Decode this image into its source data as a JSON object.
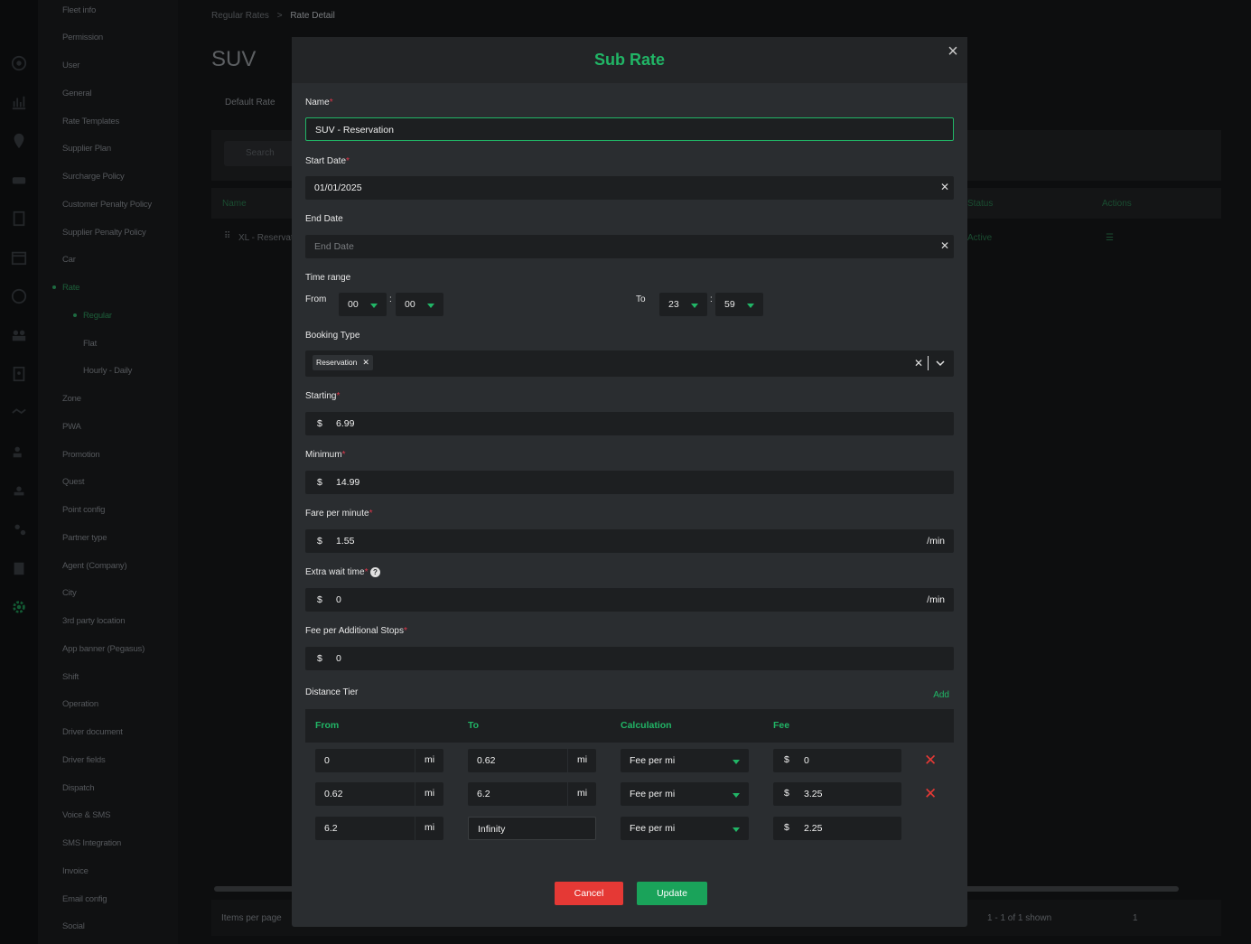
{
  "sidebar": {
    "items": [
      "Fleet info",
      "Permission",
      "User",
      "General",
      "Rate Templates",
      "Supplier Plan",
      "Surcharge Policy",
      "Customer Penalty Policy",
      "Supplier Penalty Policy",
      "Car",
      "Rate",
      "Regular",
      "Flat",
      "Hourly - Daily",
      "Zone",
      "PWA",
      "Promotion",
      "Quest",
      "Point config",
      "Partner type",
      "Agent (Company)",
      "City",
      "3rd party location",
      "App banner (Pegasus)",
      "Shift",
      "Operation",
      "Driver document",
      "Driver fields",
      "Dispatch",
      "Voice & SMS",
      "SMS Integration",
      "Invoice",
      "Email config",
      "Social"
    ]
  },
  "breadcrumb": {
    "parent": "Regular Rates",
    "sep": ">",
    "current": "Rate Detail"
  },
  "page": {
    "title": "SUV",
    "tab": "Default Rate",
    "search_placeholder": "Search"
  },
  "table": {
    "headers": {
      "name": "Name",
      "status": "Status",
      "actions": "Actions"
    },
    "row": {
      "name": "XL - Reservat",
      "status": "Active"
    }
  },
  "footer": {
    "items_per_page": "Items per page",
    "shown": "1 - 1 of 1 shown",
    "page": "1"
  },
  "modal": {
    "title": "Sub Rate",
    "close": "×",
    "name": {
      "label": "Name",
      "value": "SUV - Reservation"
    },
    "start_date": {
      "label": "Start Date",
      "value": "01/01/2025"
    },
    "end_date": {
      "label": "End Date",
      "placeholder": "End Date"
    },
    "time_range": {
      "label": "Time range",
      "from_label": "From",
      "to_label": "To",
      "from_h": "00",
      "from_m": "00",
      "to_h": "23",
      "to_m": "59",
      "colon": ":"
    },
    "booking_type": {
      "label": "Booking Type",
      "chip": "Reservation"
    },
    "starting": {
      "label": "Starting",
      "currency": "$",
      "value": "6.99"
    },
    "minimum": {
      "label": "Minimum",
      "currency": "$",
      "value": "14.99"
    },
    "fare_per_minute": {
      "label": "Fare per minute",
      "currency": "$",
      "value": "1.55",
      "unit": "/min"
    },
    "extra_wait": {
      "label": "Extra wait time",
      "currency": "$",
      "value": "0",
      "unit": "/min"
    },
    "fee_stops": {
      "label": "Fee per Additional Stops",
      "currency": "$",
      "value": "0"
    },
    "distance_tier": {
      "label": "Distance Tier",
      "add": "Add",
      "headers": {
        "from": "From",
        "to": "To",
        "calculation": "Calculation",
        "fee": "Fee"
      },
      "unit": "mi",
      "currency": "$",
      "rows": [
        {
          "from": "0",
          "to": "0.62",
          "calc": "Fee per mi",
          "fee": "0"
        },
        {
          "from": "0.62",
          "to": "6.2",
          "calc": "Fee per mi",
          "fee": "3.25"
        },
        {
          "from": "6.2",
          "to": "Infinity",
          "calc": "Fee per mi",
          "fee": "2.25"
        }
      ]
    },
    "cancel": "Cancel",
    "update": "Update"
  },
  "colors": {
    "accent": "#21b566",
    "danger": "#e53935",
    "modal_bg": "#2a2d30",
    "field_bg": "#1d1f21"
  }
}
